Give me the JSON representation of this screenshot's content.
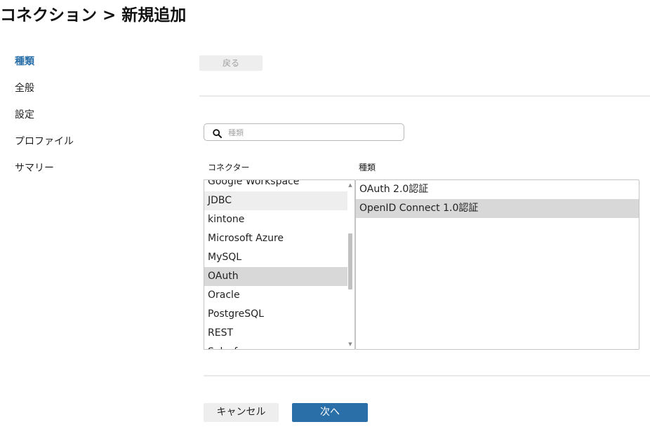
{
  "page": {
    "title": "コネクション > 新規追加"
  },
  "steps": [
    {
      "label": "種類",
      "active": true
    },
    {
      "label": "全般",
      "active": false
    },
    {
      "label": "設定",
      "active": false
    },
    {
      "label": "プロファイル",
      "active": false
    },
    {
      "label": "サマリー",
      "active": false
    }
  ],
  "toolbar": {
    "back_label": "戻る"
  },
  "search": {
    "icon": "search-icon",
    "placeholder": "種類",
    "value": ""
  },
  "columns": {
    "connector_header": "コネクター",
    "type_header": "種類"
  },
  "connectors": {
    "items": [
      "Google Workspace",
      "JDBC",
      "kintone",
      "Microsoft Azure",
      "MySQL",
      "OAuth",
      "Oracle",
      "PostgreSQL",
      "REST",
      "Salesforce"
    ],
    "hovered": "JDBC",
    "selected": "OAuth"
  },
  "types": {
    "items": [
      "OAuth 2.0認証",
      "OpenID Connect 1.0認証"
    ],
    "selected": "OpenID Connect 1.0認証"
  },
  "actions": {
    "cancel_label": "キャンセル",
    "next_label": "次へ"
  },
  "colors": {
    "accent": "#2a6fa8",
    "selected_row": "#d8d8d8",
    "hover_row": "#eeeeee"
  }
}
